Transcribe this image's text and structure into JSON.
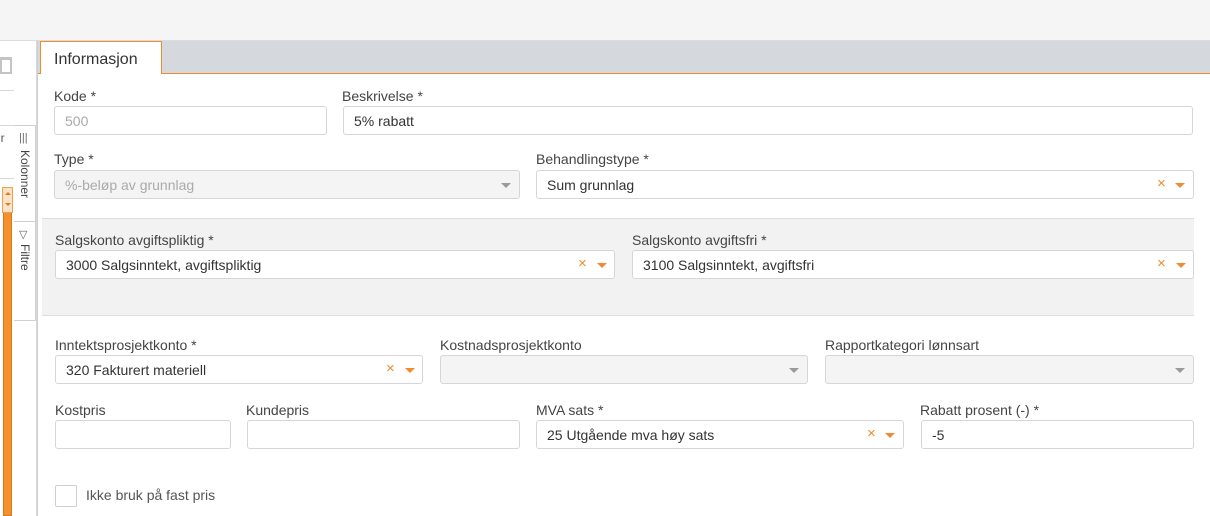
{
  "leftstrip": {
    "header_partial": "ur",
    "tabs": [
      {
        "label": "Kolonner",
        "icon": "columns-icon"
      },
      {
        "label": "Filtre",
        "icon": "filter-icon"
      }
    ]
  },
  "tab": {
    "label": "Informasjon"
  },
  "form": {
    "kode": {
      "label": "Kode *",
      "value": "500"
    },
    "beskrivelse": {
      "label": "Beskrivelse *",
      "value": "5% rabatt"
    },
    "type": {
      "label": "Type *",
      "value": "%-beløp av grunnlag"
    },
    "behandlingstype": {
      "label": "Behandlingstype *",
      "value": "Sum grunnlag"
    },
    "salgskonto_pliktig": {
      "label": "Salgskonto avgiftspliktig *",
      "value": "3000 Salgsinntekt, avgiftspliktig"
    },
    "salgskonto_fri": {
      "label": "Salgskonto avgiftsfri *",
      "value": "3100 Salgsinntekt, avgiftsfri"
    },
    "inntektsprosjektkonto": {
      "label": "Inntektsprosjektkonto *",
      "value": "320 Fakturert materiell"
    },
    "kostnadsprosjektkonto": {
      "label": "Kostnadsprosjektkonto",
      "value": ""
    },
    "rapportkategori": {
      "label": "Rapportkategori lønnsart",
      "value": ""
    },
    "kostpris": {
      "label": "Kostpris",
      "value": ""
    },
    "kundepris": {
      "label": "Kundepris",
      "value": ""
    },
    "mva": {
      "label": "MVA sats *",
      "value": "25 Utgående mva høy sats"
    },
    "rabatt": {
      "label": "Rabatt prosent (-) *",
      "value": "-5"
    },
    "fastpris": {
      "label": "Ikke bruk på fast pris",
      "checked": false
    }
  },
  "colors": {
    "accent": "#f08c2d",
    "tabstrip": "#d5d9dd"
  }
}
